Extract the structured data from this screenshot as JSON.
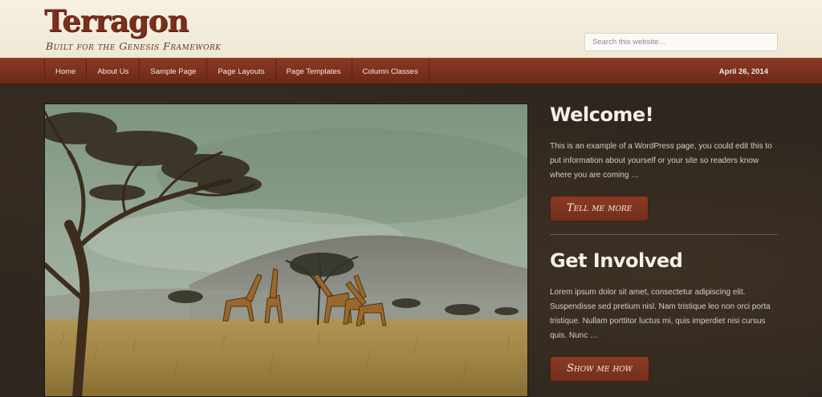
{
  "site": {
    "title": "Terragon",
    "tagline": "Built for the Genesis Framework"
  },
  "search": {
    "placeholder": "Search this website…"
  },
  "nav": {
    "items": [
      {
        "label": "Home"
      },
      {
        "label": "About Us"
      },
      {
        "label": "Sample Page"
      },
      {
        "label": "Page Layouts"
      },
      {
        "label": "Page Templates"
      },
      {
        "label": "Column Classes"
      }
    ],
    "date": "April 26, 2014"
  },
  "widgets": [
    {
      "title": "Welcome!",
      "text": "This is an example of a WordPress page, you could edit this to put information about yourself or your site so readers know where you are coming …",
      "button": "Tell me more"
    },
    {
      "title": "Get Involved",
      "text": "Lorem ipsum dolor sit amet, consectetur adipiscing elit. Suspendisse sed pretium nisl. Nam tristique leo non orci porta tristique. Nullam porttitor luctus mi, quis imperdiet nisi cursus quis. Nunc …",
      "button": "Show me how"
    }
  ],
  "colors": {
    "brand": "#7a2e1b",
    "nav": "#7a301c",
    "background": "#2e261f"
  }
}
